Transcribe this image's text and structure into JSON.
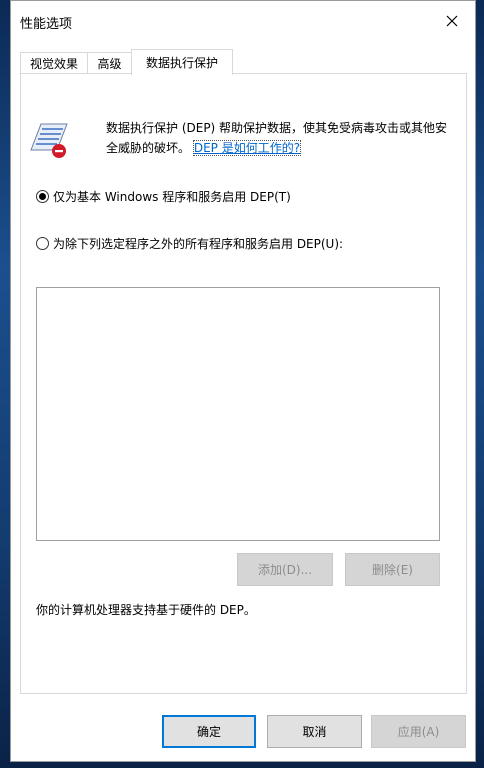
{
  "window": {
    "title": "性能选项"
  },
  "tabs": [
    {
      "label": "视觉效果"
    },
    {
      "label": "高级"
    },
    {
      "label": "数据执行保护"
    }
  ],
  "dep": {
    "description": "数据执行保护 (DEP) 帮助保护数据，使其免受病毒攻击或其他安全威胁的破坏。",
    "link_text": "DEP 是如何工作的?",
    "icon": "dep-shield-icon"
  },
  "options": {
    "essential": {
      "label": "仅为基本 Windows 程序和服务启用 DEP(T)",
      "selected": true
    },
    "all_except": {
      "label": "为除下列选定程序之外的所有程序和服务启用 DEP(U):",
      "selected": false
    }
  },
  "list": {
    "items": []
  },
  "list_buttons": {
    "add": "添加(D)...",
    "remove": "删除(E)"
  },
  "status": "你的计算机处理器支持基于硬件的 DEP。",
  "footer": {
    "ok": "确定",
    "cancel": "取消",
    "apply": "应用(A)"
  },
  "colors": {
    "link": "#0066cc",
    "accent": "#0078d7"
  }
}
